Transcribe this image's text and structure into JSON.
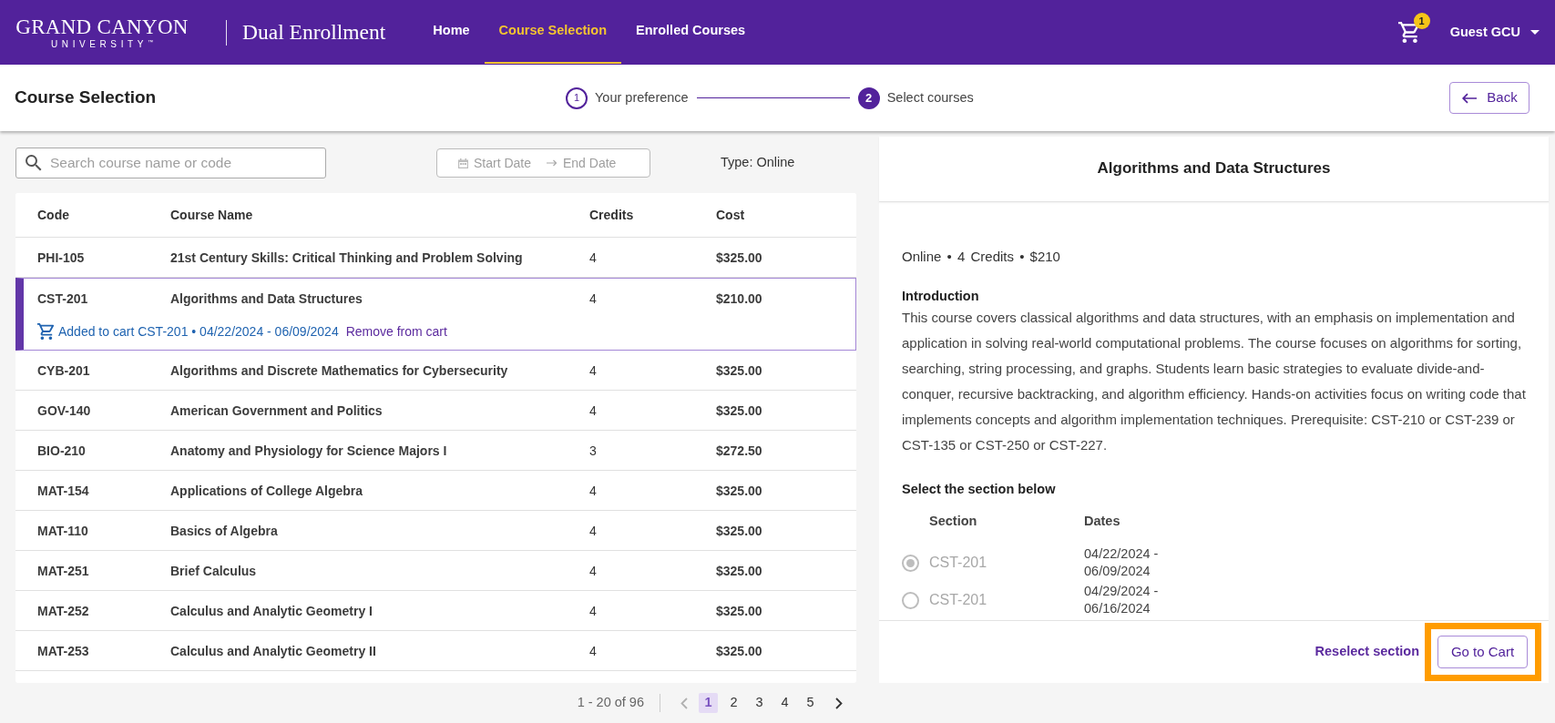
{
  "header": {
    "logo": {
      "wordmark": "GRAND CANYON",
      "subtitle": "UNIVERSITY$^{™}$"
    },
    "app_title": "Dual Enrollment",
    "nav": [
      {
        "label": "Home",
        "selected": false
      },
      {
        "label": "Course Selection",
        "selected": true
      },
      {
        "label": "Enrolled Courses",
        "selected": false
      }
    ],
    "cart": {
      "count": "1"
    },
    "user": {
      "name": "Guest GCU"
    }
  },
  "page_header": {
    "title": "Course Selection",
    "steps": [
      {
        "number": "1",
        "label": "Your preference",
        "current": false
      },
      {
        "number": "2",
        "label": "Select courses",
        "current": true
      }
    ],
    "back_button": "Back"
  },
  "filters": {
    "search": {
      "placeholder": "Search course name or code"
    },
    "date_range": {
      "start_placeholder": "Start Date",
      "end_placeholder": "End Date"
    },
    "type": "Type: Online"
  },
  "table": {
    "columns": [
      "Code",
      "Course Name",
      "Credits",
      "Cost"
    ],
    "rows": [
      {
        "code": "PHI-105",
        "name": "21st Century Skills: Critical Thinking and Problem Solving",
        "credits": "4",
        "cost": "$325.00",
        "selected": false
      },
      {
        "code": "CST-201",
        "name": "Algorithms and Data Structures",
        "credits": "4",
        "cost": "$210.00",
        "selected": true,
        "cart": {
          "note": "Added to cart CST-201 • 04/22/2024 - 06/09/2024",
          "action": "Remove from cart"
        }
      },
      {
        "code": "CYB-201",
        "name": "Algorithms and Discrete Mathematics for Cybersecurity",
        "credits": "4",
        "cost": "$325.00",
        "selected": false
      },
      {
        "code": "GOV-140",
        "name": "American Government and Politics",
        "credits": "4",
        "cost": "$325.00",
        "selected": false
      },
      {
        "code": "BIO-210",
        "name": "Anatomy and Physiology for Science Majors I",
        "credits": "3",
        "cost": "$272.50",
        "selected": false
      },
      {
        "code": "MAT-154",
        "name": "Applications of College Algebra",
        "credits": "4",
        "cost": "$325.00",
        "selected": false
      },
      {
        "code": "MAT-110",
        "name": "Basics of Algebra",
        "credits": "4",
        "cost": "$325.00",
        "selected": false
      },
      {
        "code": "MAT-251",
        "name": "Brief Calculus",
        "credits": "4",
        "cost": "$325.00",
        "selected": false
      },
      {
        "code": "MAT-252",
        "name": "Calculus and Analytic Geometry I",
        "credits": "4",
        "cost": "$325.00",
        "selected": false
      },
      {
        "code": "MAT-253",
        "name": "Calculus and Analytic Geometry II",
        "credits": "4",
        "cost": "$325.00",
        "selected": false
      }
    ]
  },
  "pagination": {
    "range": "1 - 20 of 96",
    "previous": {
      "disabled": true
    },
    "pages": [
      {
        "label": "1",
        "selected": true
      },
      {
        "label": "2",
        "selected": false
      },
      {
        "label": "3",
        "selected": false
      },
      {
        "label": "4",
        "selected": false
      },
      {
        "label": "5",
        "selected": false
      }
    ],
    "next": {
      "disabled": false
    }
  },
  "details": {
    "title": "Algorithms and Data Structures",
    "meta": "Online • 4 Credits • $210",
    "intro_heading": "Introduction",
    "intro_text": "This course covers classical algorithms and data structures, with an emphasis on implementation and application in solving real-world computational problems. The course focuses on algorithms for sorting, searching, string processing, and graphs. Students learn basic strategies to evaluate divide-and-conquer, recursive backtracking, and algorithm efficiency. Hands-on activities focus on writing code that implements concepts and algorithm implementation techniques. Prerequisite: CST-210 or CST-239 or CST-135 or CST-250 or CST-227.",
    "sections_heading": "Select the section below",
    "section_columns": [
      "Section",
      "Dates"
    ],
    "sections": [
      {
        "code": "CST-201",
        "dates": "04/22/2024 - 06/09/2024",
        "selected": true,
        "disabled": true
      },
      {
        "code": "CST-201",
        "dates": "04/29/2024 - 06/16/2024",
        "selected": false,
        "disabled": true
      }
    ],
    "reselect_link": "Reselect section",
    "cart_button": {
      "label": "Go to Cart",
      "highlighted": true
    }
  }
}
